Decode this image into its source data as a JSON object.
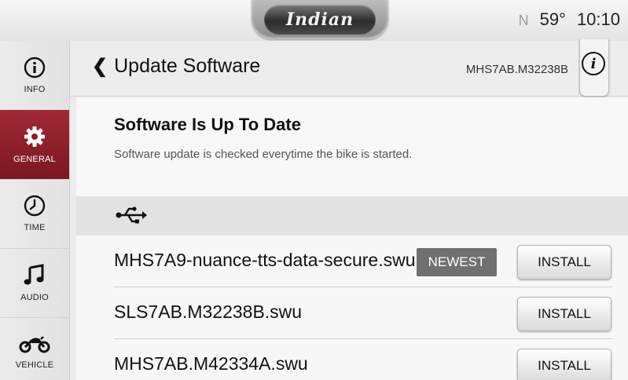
{
  "status_bar": {
    "brand": "Indian",
    "gear": "N",
    "temperature": "59°",
    "time": "10:10"
  },
  "sidebar": {
    "items": [
      {
        "label": "INFO",
        "icon": "info-icon",
        "active": false
      },
      {
        "label": "GENERAL",
        "icon": "gear-icon",
        "active": true
      },
      {
        "label": "TIME",
        "icon": "clock-icon",
        "active": false
      },
      {
        "label": "AUDIO",
        "icon": "music-note-icon",
        "active": false
      },
      {
        "label": "VEHICLE",
        "icon": "motorcycle-icon",
        "active": false
      }
    ]
  },
  "header": {
    "title": "Update Software",
    "version": "MHS7AB.M32238B",
    "info_glyph": "i"
  },
  "status": {
    "title": "Software Is Up To Date",
    "subtitle": "Software update is checked everytime the bike is started."
  },
  "usb_section": {
    "icon": "usb-icon"
  },
  "files": [
    {
      "name": "MHS7A9-nuance-tts-data-secure.swu",
      "badge": "NEWEST",
      "action": "INSTALL"
    },
    {
      "name": "SLS7AB.M32238B.swu",
      "badge": "",
      "action": "INSTALL"
    },
    {
      "name": "MHS7AB.M42334A.swu",
      "badge": "",
      "action": "INSTALL"
    }
  ],
  "colors": {
    "accent": "#8c1f2a",
    "badge": "#707070"
  }
}
